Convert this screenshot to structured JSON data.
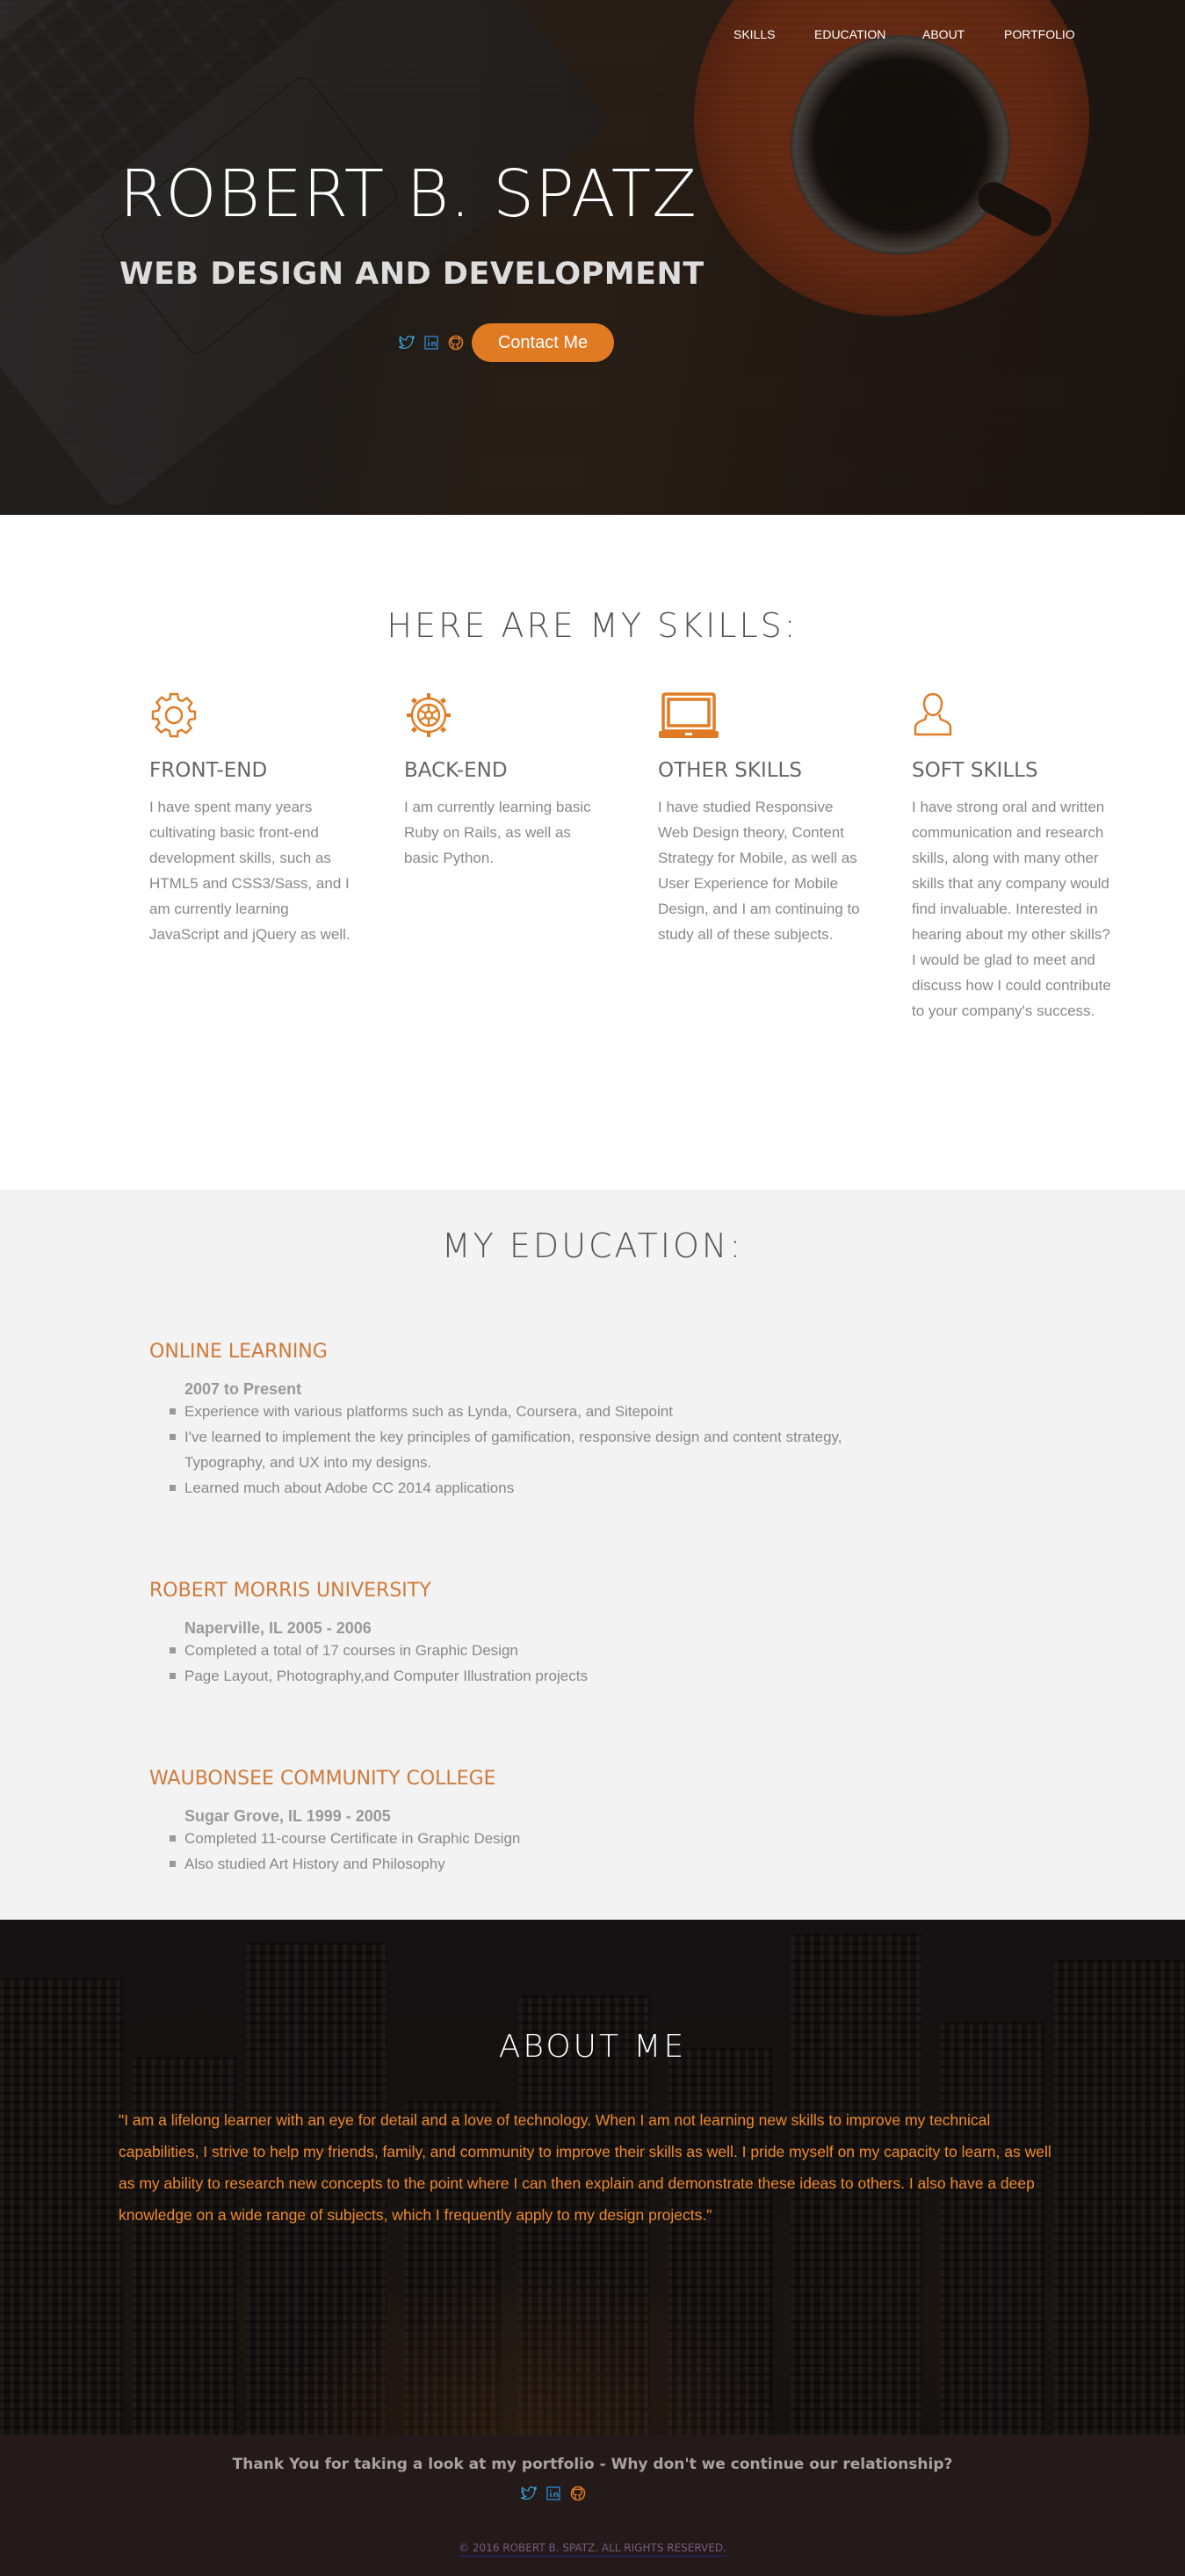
{
  "nav": {
    "items": [
      "SKILLS",
      "EDUCATION",
      "ABOUT",
      "PORTFOLIO"
    ]
  },
  "hero": {
    "name": "ROBERT B. SPATZ",
    "subtitle": "WEB DESIGN AND DEVELOPMENT",
    "contact_label": "Contact Me",
    "social_icons": [
      "twitter-icon",
      "linkedin-icon",
      "github-icon"
    ]
  },
  "skills": {
    "title": "HERE ARE MY SKILLS:",
    "items": [
      {
        "icon": "gear-icon",
        "title": "FRONT-END",
        "text": "I have spent many years cultivating basic front-end development skills, such as HTML5 and CSS3/Sass, and I am currently learning JavaScript and jQuery as well."
      },
      {
        "icon": "cog-wheel-icon",
        "title": "BACK-END",
        "text": "I am currently learning basic Ruby on Rails, as well as basic Python."
      },
      {
        "icon": "laptop-icon",
        "title": "OTHER SKILLS",
        "text": "I have studied Responsive Web Design theory, Content Strategy for Mobile, as well as User Experience for Mobile Design, and I am continuing to study all of these subjects."
      },
      {
        "icon": "user-icon",
        "title": "SOFT SKILLS",
        "text": "I have strong oral and written communication and research skills, along with many other skills that any company would find invaluable. Interested in hearing about my other skills? I would be glad to meet and discuss how I could contribute to your company's success."
      }
    ]
  },
  "education": {
    "title": "MY EDUCATION:",
    "entries": [
      {
        "name": "ONLINE LEARNING",
        "meta": "2007 to Present",
        "points": [
          "Experience with various platforms such as Lynda, Coursera, and Sitepoint",
          "I've learned to implement the key principles of gamification, responsive design and content strategy, Typography, and UX into my designs.",
          "Learned much about Adobe CC 2014 applications"
        ]
      },
      {
        "name": "ROBERT MORRIS UNIVERSITY",
        "meta": "Naperville, IL 2005 - 2006",
        "points": [
          "Completed a total of 17 courses in Graphic Design",
          "Page Layout, Photography,and Computer Illustration projects"
        ]
      },
      {
        "name": "WAUBONSEE COMMUNITY COLLEGE",
        "meta": "Sugar Grove, IL 1999 - 2005",
        "points": [
          "Completed 11-course Certificate in Graphic Design",
          "Also studied Art History and Philosophy"
        ]
      }
    ]
  },
  "about": {
    "title": "ABOUT ME",
    "text": "\"I am a lifelong learner with an eye for detail and a love of technology. When I am not learning new skills to improve my technical capabilities, I strive to help my friends, family, and community to improve their skills as well. I pride myself on my capacity to learn, as well as my ability to research new concepts to the point where I can then explain and demonstrate these ideas to others. I also have a deep knowledge on a wide range of subjects, which I frequently apply to my design projects.\""
  },
  "footer": {
    "thanks": "Thank You for taking a look at my portfolio - Why don't we continue our relationship?",
    "copyright": "© 2016 ROBERT B. SPATZ. ALL RIGHTS RESERVED."
  },
  "colors": {
    "accent": "#e07b24",
    "twitter": "#3aa4d8",
    "linkedin": "#2d7dbb",
    "github": "#e07b24"
  }
}
